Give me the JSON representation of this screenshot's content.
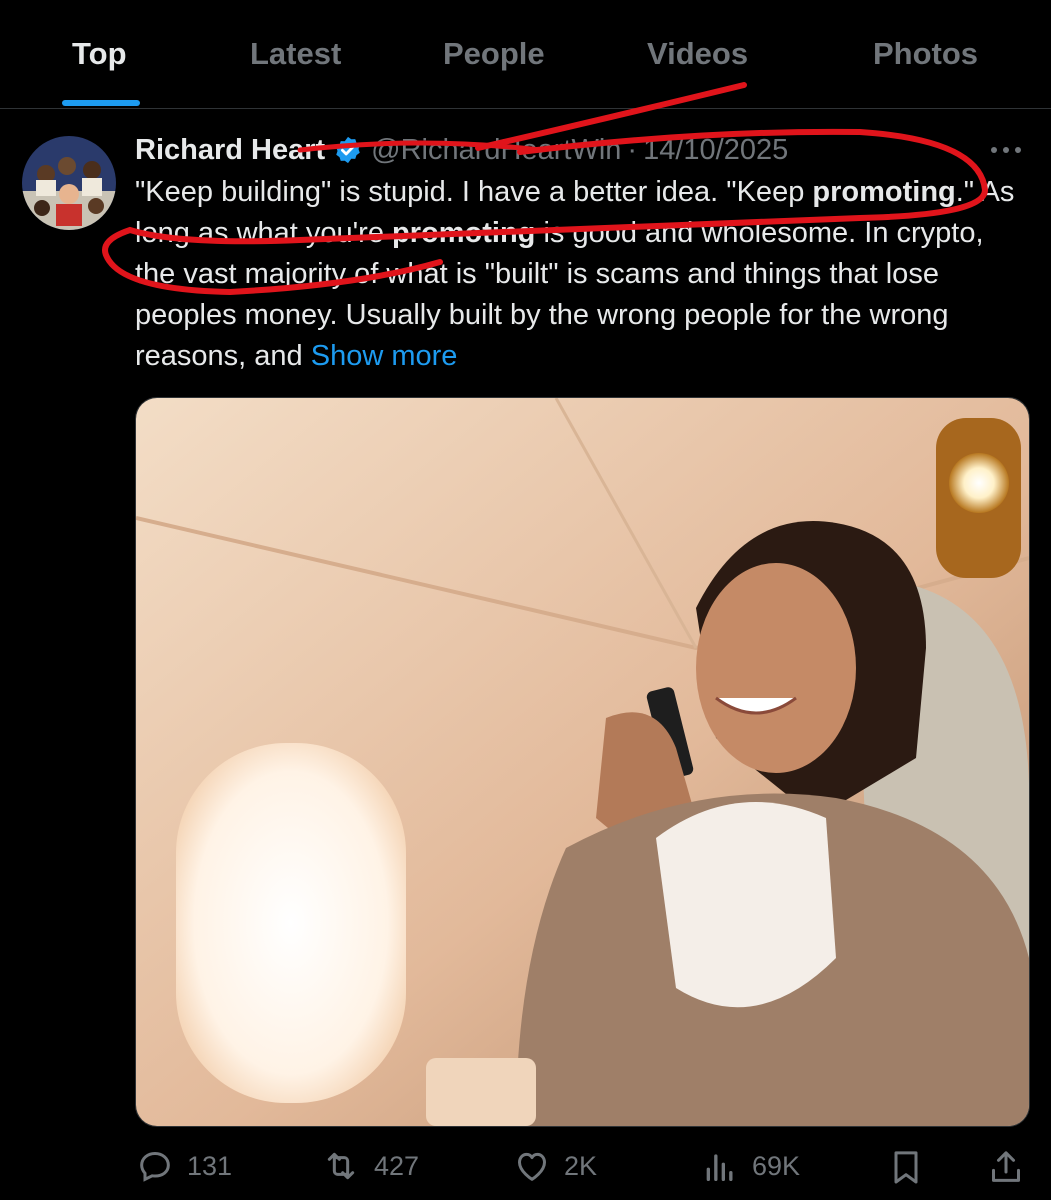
{
  "tabs": [
    {
      "label": "Top",
      "active": true
    },
    {
      "label": "Latest",
      "active": false
    },
    {
      "label": "People",
      "active": false
    },
    {
      "label": "Videos",
      "active": false
    },
    {
      "label": "Photos",
      "active": false
    }
  ],
  "tweet": {
    "author_name": "Richard Heart",
    "handle": "@RichardHeartWin",
    "separator": "·",
    "date": "14/10/2025",
    "text_segments": {
      "s1": "\"Keep building\" is stupid. I have a better idea. \"Keep ",
      "b1": "promoting",
      "s2": ".\" As long as what you're ",
      "b2": "promoting",
      "s3": " is good and wholesome. In crypto, the vast majority of what is \"built\" is scams and things that lose peoples money. Usually built by the wrong people for the wrong reasons, and "
    },
    "show_more_label": "Show more",
    "stats": {
      "replies": "131",
      "reposts": "427",
      "likes": "2K",
      "views": "69K"
    }
  },
  "icons": {
    "verified": "verified-badge-icon",
    "more": "more-options-icon",
    "reply": "reply-icon",
    "repost": "repost-icon",
    "like": "heart-icon",
    "views": "views-chart-icon",
    "bookmark": "bookmark-icon",
    "share": "share-icon"
  },
  "colors": {
    "background": "#000000",
    "accent": "#1d9bf0",
    "muted": "#71767b",
    "text": "#e7e9ea",
    "annotation": "#e0141b"
  }
}
